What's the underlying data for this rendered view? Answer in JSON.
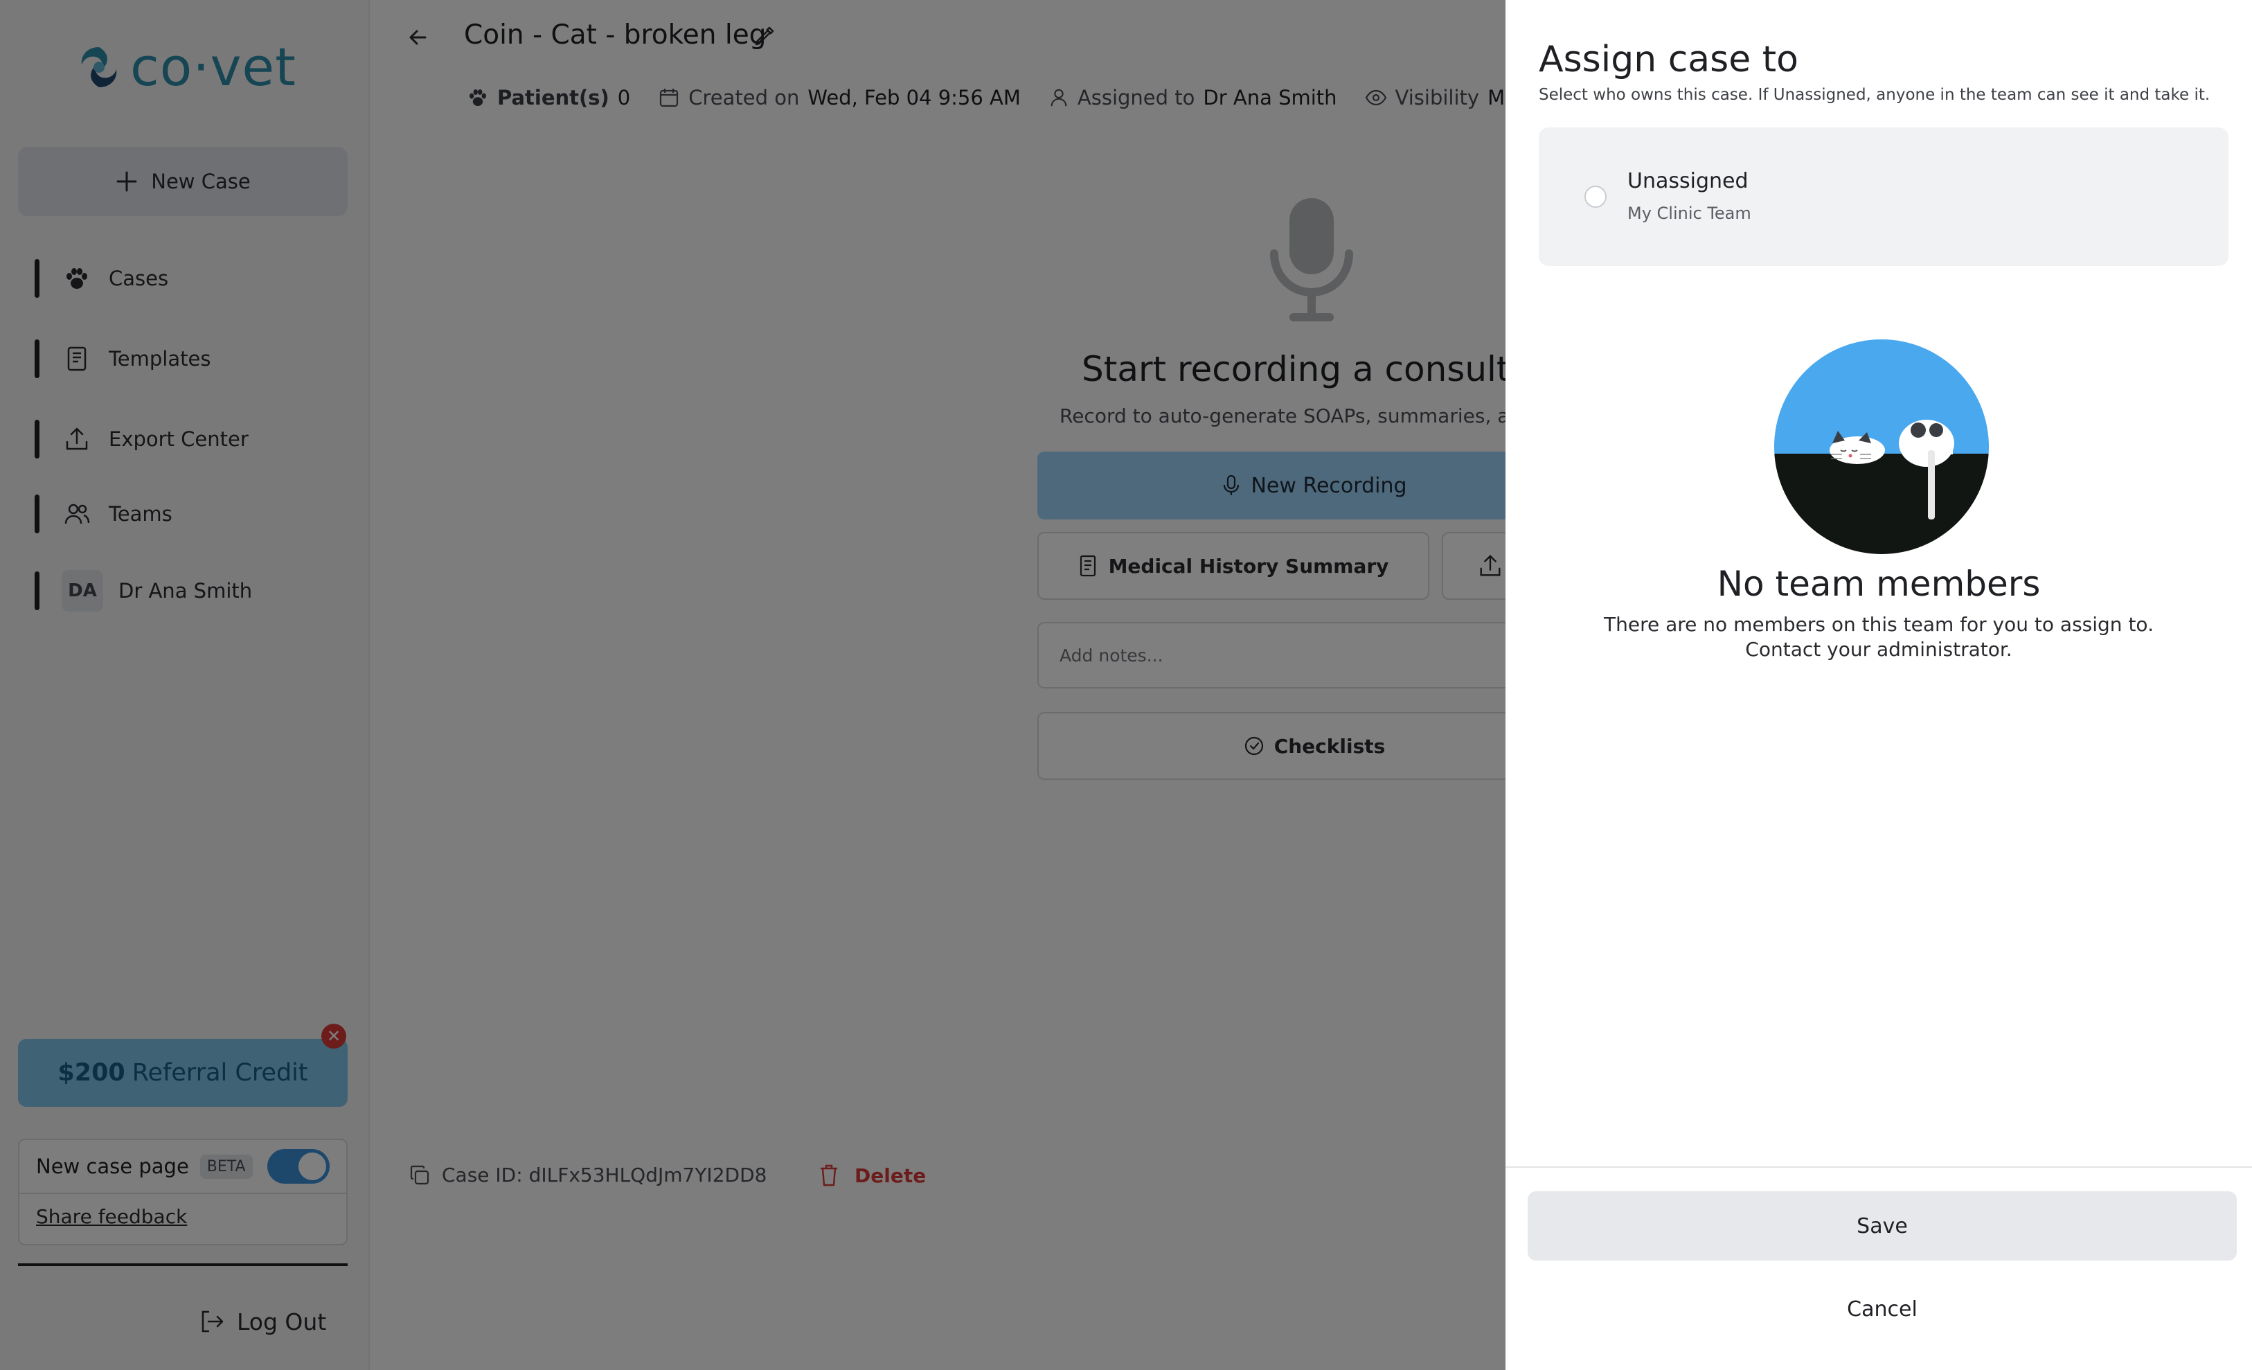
{
  "sidebar": {
    "logo": "co·vet",
    "new_case_label": "New Case",
    "items": [
      {
        "label": "Cases",
        "icon": "paw-icon"
      },
      {
        "label": "Templates",
        "icon": "document-icon"
      },
      {
        "label": "Export Center",
        "icon": "upload-icon"
      },
      {
        "label": "Teams",
        "icon": "users-icon"
      },
      {
        "label": "Dr Ana Smith",
        "icon": "avatar",
        "initials": "DA"
      }
    ],
    "referral": {
      "amount": "$200",
      "label": "Referral Credit"
    },
    "beta": {
      "label": "New case page",
      "badge": "BETA",
      "enabled": true,
      "feedback": "Share feedback"
    },
    "logout_label": "Log Out"
  },
  "case": {
    "title": "Coin - Cat - broken leg",
    "patients_label": "Patient(s)",
    "patients_count": "0",
    "created_label": "Created on",
    "created_value": "Wed, Feb 04 9:56 AM",
    "assigned_label": "Assigned to",
    "assigned_value": "Dr Ana Smith",
    "visibility_label": "Visibility",
    "visibility_value": "My Clinic",
    "start_title": "Start recording a consultati",
    "start_sub": "Record to auto-generate SOAPs, summaries, and",
    "new_recording": "New Recording",
    "medical_history": "Medical History Summary",
    "notes_placeholder": "Add notes...",
    "checklists": "Checklists",
    "case_id": "Case ID: dILFx53HLQdJm7YI2DD8",
    "delete_label": "Delete"
  },
  "drawer": {
    "title": "Assign case to",
    "subtitle": "Select who owns this case. If Unassigned, anyone in the team can see it and take it.",
    "option_label": "Unassigned",
    "option_sub": "My Clinic Team",
    "empty_title": "No team members",
    "empty_line1": "There are no members on this team for you to assign to.",
    "empty_line2": "Contact your administrator.",
    "save_label": "Save",
    "cancel_label": "Cancel"
  },
  "colors": {
    "brand": "#2c8aa6",
    "accent": "#3c8fd8",
    "danger": "#d93a37",
    "illustration_sky": "#4aa8ef"
  }
}
